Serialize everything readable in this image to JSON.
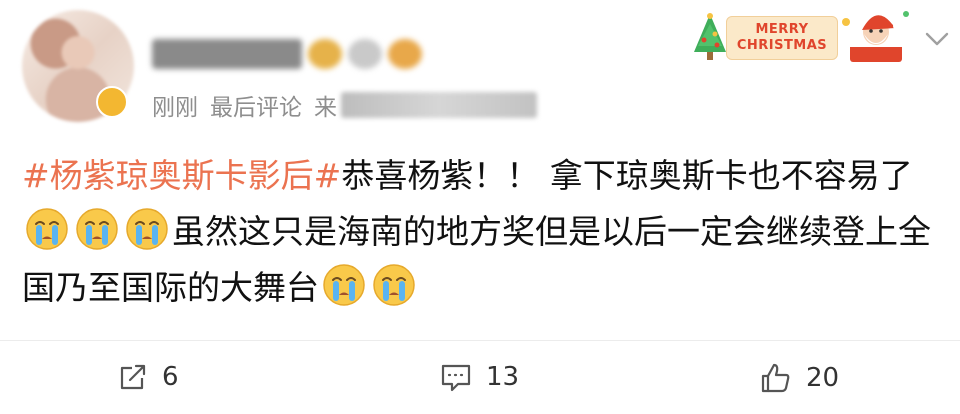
{
  "post": {
    "author": {
      "name": ""
    },
    "meta": {
      "time": "刚刚",
      "label": "最后评论",
      "source_prefix": "来"
    },
    "badge": {
      "line1": "MERRY",
      "line2": "CHRISTMAS"
    },
    "content": {
      "topic": "#杨紫琼奥斯卡影后#",
      "text1": "恭喜杨紫！！ 拿下琼奥斯卡也不容易了",
      "text2": "虽然这只是海南的地方奖但是以后一定会继续登上全国乃至国际的大舞台"
    },
    "actions": {
      "repost_count": "6",
      "comment_count": "13",
      "like_count": "20"
    }
  },
  "colors": {
    "topic": "#eb7350",
    "meta_text": "#8e8e8e",
    "badge_text": "#e0452c"
  },
  "icons": [
    "repost-icon",
    "comment-icon",
    "like-icon",
    "chevron-down-icon",
    "crying-emoji-icon"
  ]
}
